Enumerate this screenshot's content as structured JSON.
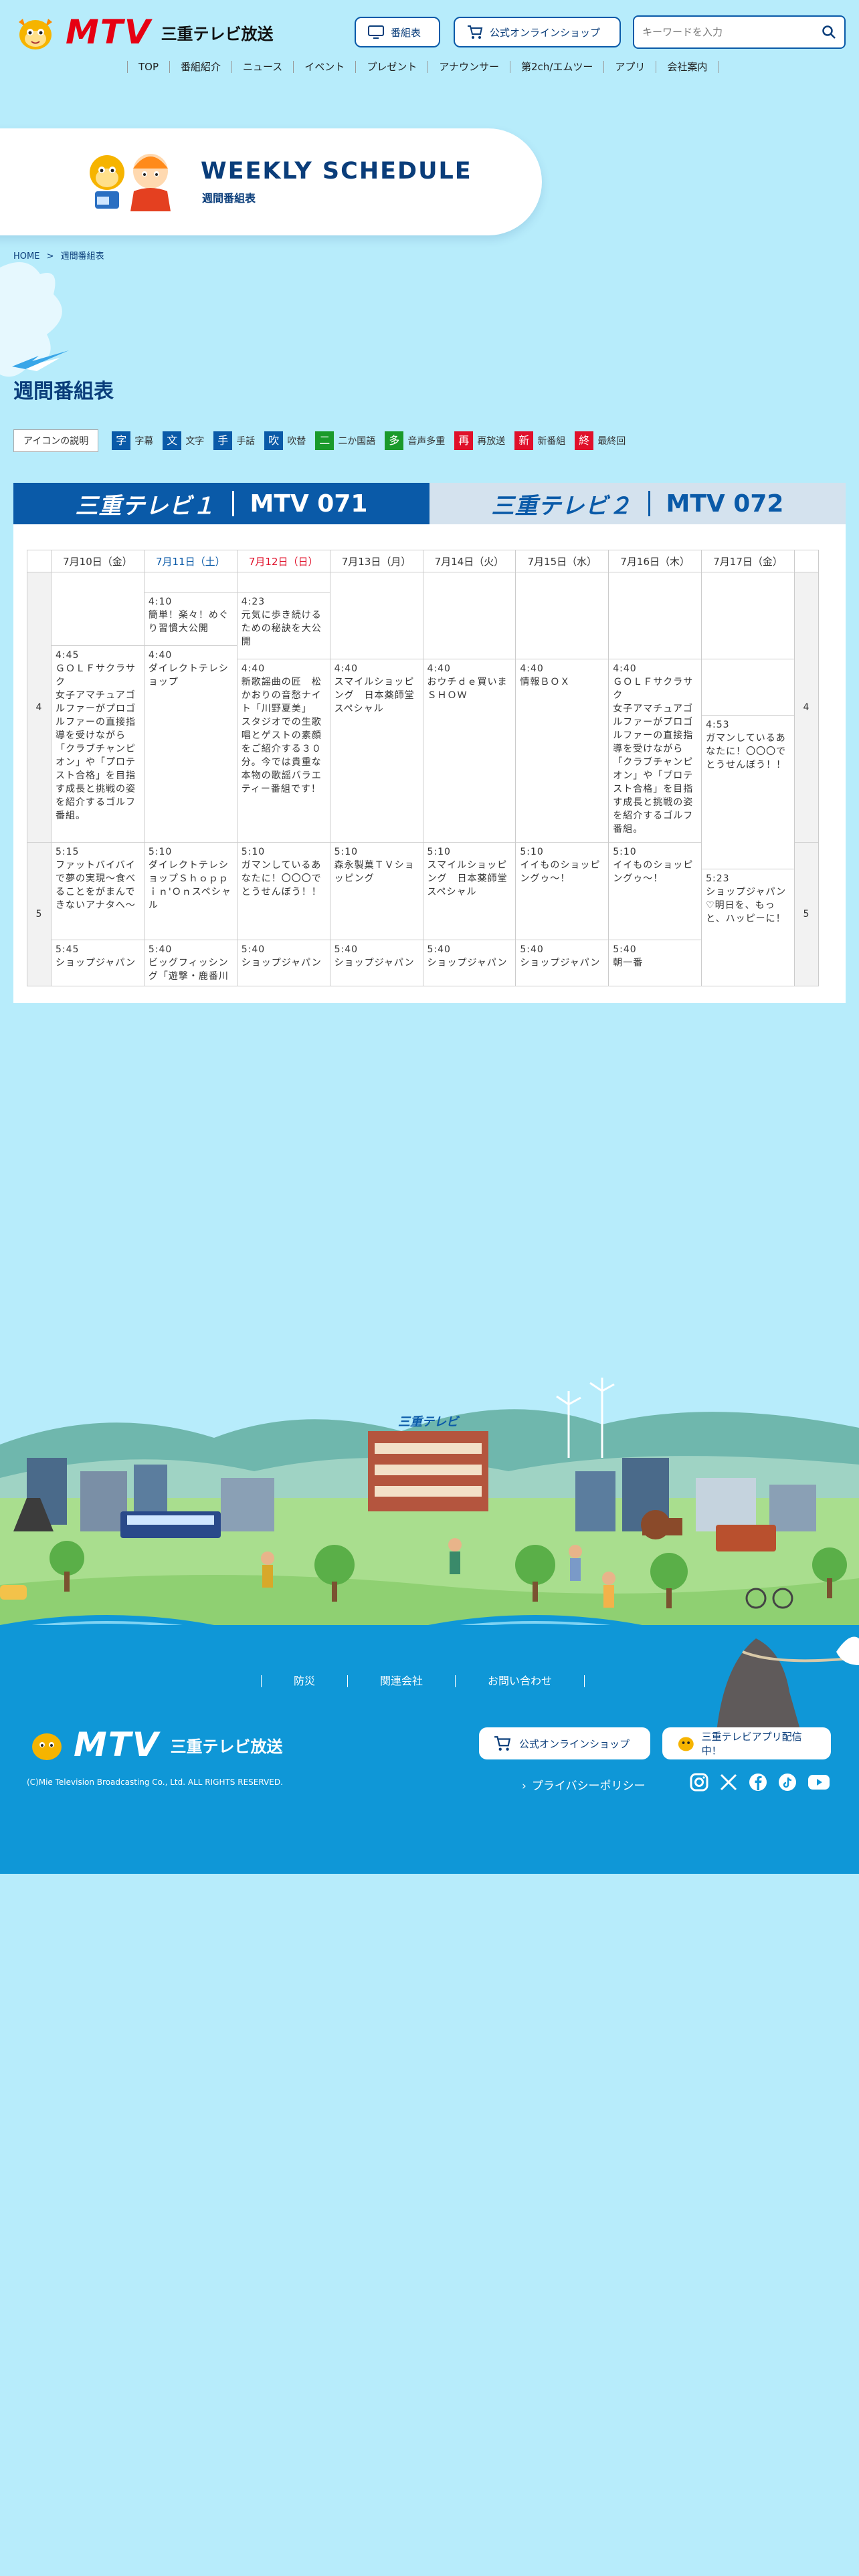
{
  "header": {
    "brand_logo": "MTV",
    "brand_name": "三重テレビ放送",
    "btn_schedule": "番組表",
    "btn_shop": "公式オンラインショップ",
    "search_placeholder": "キーワードを入力",
    "nav": [
      "TOP",
      "番組紹介",
      "ニュース",
      "イベント",
      "プレゼント",
      "アナウンサー",
      "第2ch/エムツー",
      "アプリ",
      "会社案内"
    ]
  },
  "hero": {
    "title": "WEEKLY SCHEDULE",
    "subtitle": "週間番組表"
  },
  "breadcrumb": {
    "home": "HOME",
    "sep": ">",
    "current": "週間番組表"
  },
  "page_heading": "週間番組表",
  "legend": {
    "button": "アイコンの説明",
    "items": [
      {
        "icon": "字",
        "label": "字幕",
        "color": "#0a5aa8"
      },
      {
        "icon": "文",
        "label": "文字",
        "color": "#0a5aa8"
      },
      {
        "icon": "手",
        "label": "手話",
        "color": "#0a5aa8"
      },
      {
        "icon": "吹",
        "label": "吹替",
        "color": "#0a5aa8"
      },
      {
        "icon": "二",
        "label": "二か国語",
        "color": "#1a9a2a"
      },
      {
        "icon": "多",
        "label": "音声多重",
        "color": "#1a9a2a"
      },
      {
        "icon": "再",
        "label": "再放送",
        "color": "#e0102a"
      },
      {
        "icon": "新",
        "label": "新番組",
        "color": "#e0102a"
      },
      {
        "icon": "終",
        "label": "最終回",
        "color": "#e0102a"
      }
    ]
  },
  "tabs": {
    "ch1": {
      "label": "三重テレビ１",
      "num": "MTV 071"
    },
    "ch2": {
      "label": "三重テレビ２",
      "num": "MTV 072"
    }
  },
  "schedule": {
    "days": [
      "7月10日（金）",
      "7月11日（土）",
      "7月12日（日）",
      "7月13日（月）",
      "7月14日（火）",
      "7月15日（水）",
      "7月16日（木）",
      "7月17日（金）"
    ],
    "day_colors": [
      "#333333",
      "#0a5aa8",
      "#e0102a",
      "#333333",
      "#333333",
      "#333333",
      "#333333",
      "#333333"
    ],
    "hours": [
      "4",
      "5"
    ],
    "programs": {
      "d1_a": {
        "time": "4:45",
        "title": "ＧＯＬＦサクラサク"
      },
      "d1_a_desc": "女子アマチュアゴルファーがプロゴルファーの直接指導を受けながら「クラブチャンピオン」や「プロテスト合格」を目指す成長と挑戦の姿を紹介するゴルフ番組。",
      "d1_b": {
        "time": "5:15",
        "title": "ファットバイバイで夢の実現～食べることをがまんできないアナタへ～"
      },
      "d1_c": {
        "time": "5:45",
        "title": "ショップジャパン"
      },
      "d2_a": {
        "time": "4:10",
        "title": "簡単！楽々！めぐり習慣大公開"
      },
      "d2_b": {
        "time": "4:40",
        "title": "ダイレクトテレショップ"
      },
      "d2_c": {
        "time": "5:10",
        "title": "ダイレクトテレショップＳｈｏｐｐｉｎ'Ｏｎスペシャル"
      },
      "d2_d": {
        "time": "5:40",
        "title": "ビッグフィッシング「遊撃・鹿番川"
      },
      "d3_a": {
        "time": "4:23",
        "title": "元気に歩き続けるための秘訣を大公開"
      },
      "d3_b": {
        "time": "4:53",
        "title": "ガマンしているあなたに！〇〇〇でとうせんぼう！！"
      },
      "d3_c": {
        "time": "5:23",
        "title": "ショップジャパン♡明日を、もっと、ハッピーに！"
      },
      "d4_a": {
        "time": "4:40",
        "title": "新歌謡曲の匠　松かおりの音愁ナイト「川野夏美」"
      },
      "d4_a_desc": "スタジオでの生歌唱とゲストの素顔をご紹介する３０分。今では貴重な本物の歌謡バラエティー番組です！",
      "d4_b": {
        "time": "5:10",
        "title": "ガマンしているあなたに！〇〇〇でとうせんぼう！！"
      },
      "d4_c": {
        "time": "5:40",
        "title": "ショップジャパン"
      },
      "d5_a": {
        "time": "4:40",
        "title": "スマイルショッピング　日本薬師堂スペシャル"
      },
      "d5_b": {
        "time": "5:10",
        "title": "森永製菓ＴＶショッピング"
      },
      "d5_c": {
        "time": "5:40",
        "title": "ショップジャパン"
      },
      "d6_a": {
        "time": "4:40",
        "title": "おウチｄｅ買いまＳＨＯＷ"
      },
      "d6_b": {
        "time": "5:10",
        "title": "スマイルショッピング　日本薬師堂スペシャル"
      },
      "d6_c": {
        "time": "5:40",
        "title": "ショップジャパン"
      },
      "d7_a": {
        "time": "4:40",
        "title": "情報ＢＯＸ"
      },
      "d7_b": {
        "time": "5:10",
        "title": "イイものショッピングゥ～！"
      },
      "d7_c": {
        "time": "5:40",
        "title": "ショップジャパン"
      },
      "d8_a": {
        "time": "4:40",
        "title": "ＧＯＬＦサクラサク"
      },
      "d8_a_desc": "女子アマチュアゴルファーがプロゴルファーの直接指導を受けながら「クラブチャンピオン」や「プロテスト合格」を目指す成長と挑戦の姿を紹介するゴルフ番組。",
      "d8_b": {
        "time": "5:10",
        "title": "イイものショッピングゥ～！"
      },
      "d8_c": {
        "time": "5:40",
        "title": "朝一番"
      }
    }
  },
  "scene": {
    "building_sign": "三重テレビ"
  },
  "footer": {
    "links": [
      "防災",
      "関連会社",
      "お問い合わせ"
    ],
    "brand_logo": "MTV",
    "brand_name": "三重テレビ放送",
    "btn_shop": "公式オンラインショップ",
    "btn_app": "三重テレビアプリ配信中！",
    "privacy": "プライバシーポリシー",
    "copyright": "(C)Mie Television Broadcasting Co., Ltd. ALL RIGHTS RESERVED."
  },
  "colors": {
    "brand_red": "#e60012",
    "brand_blue": "#0a5aa8",
    "sky": "#b7ecfb",
    "footer": "#0f97d7"
  }
}
